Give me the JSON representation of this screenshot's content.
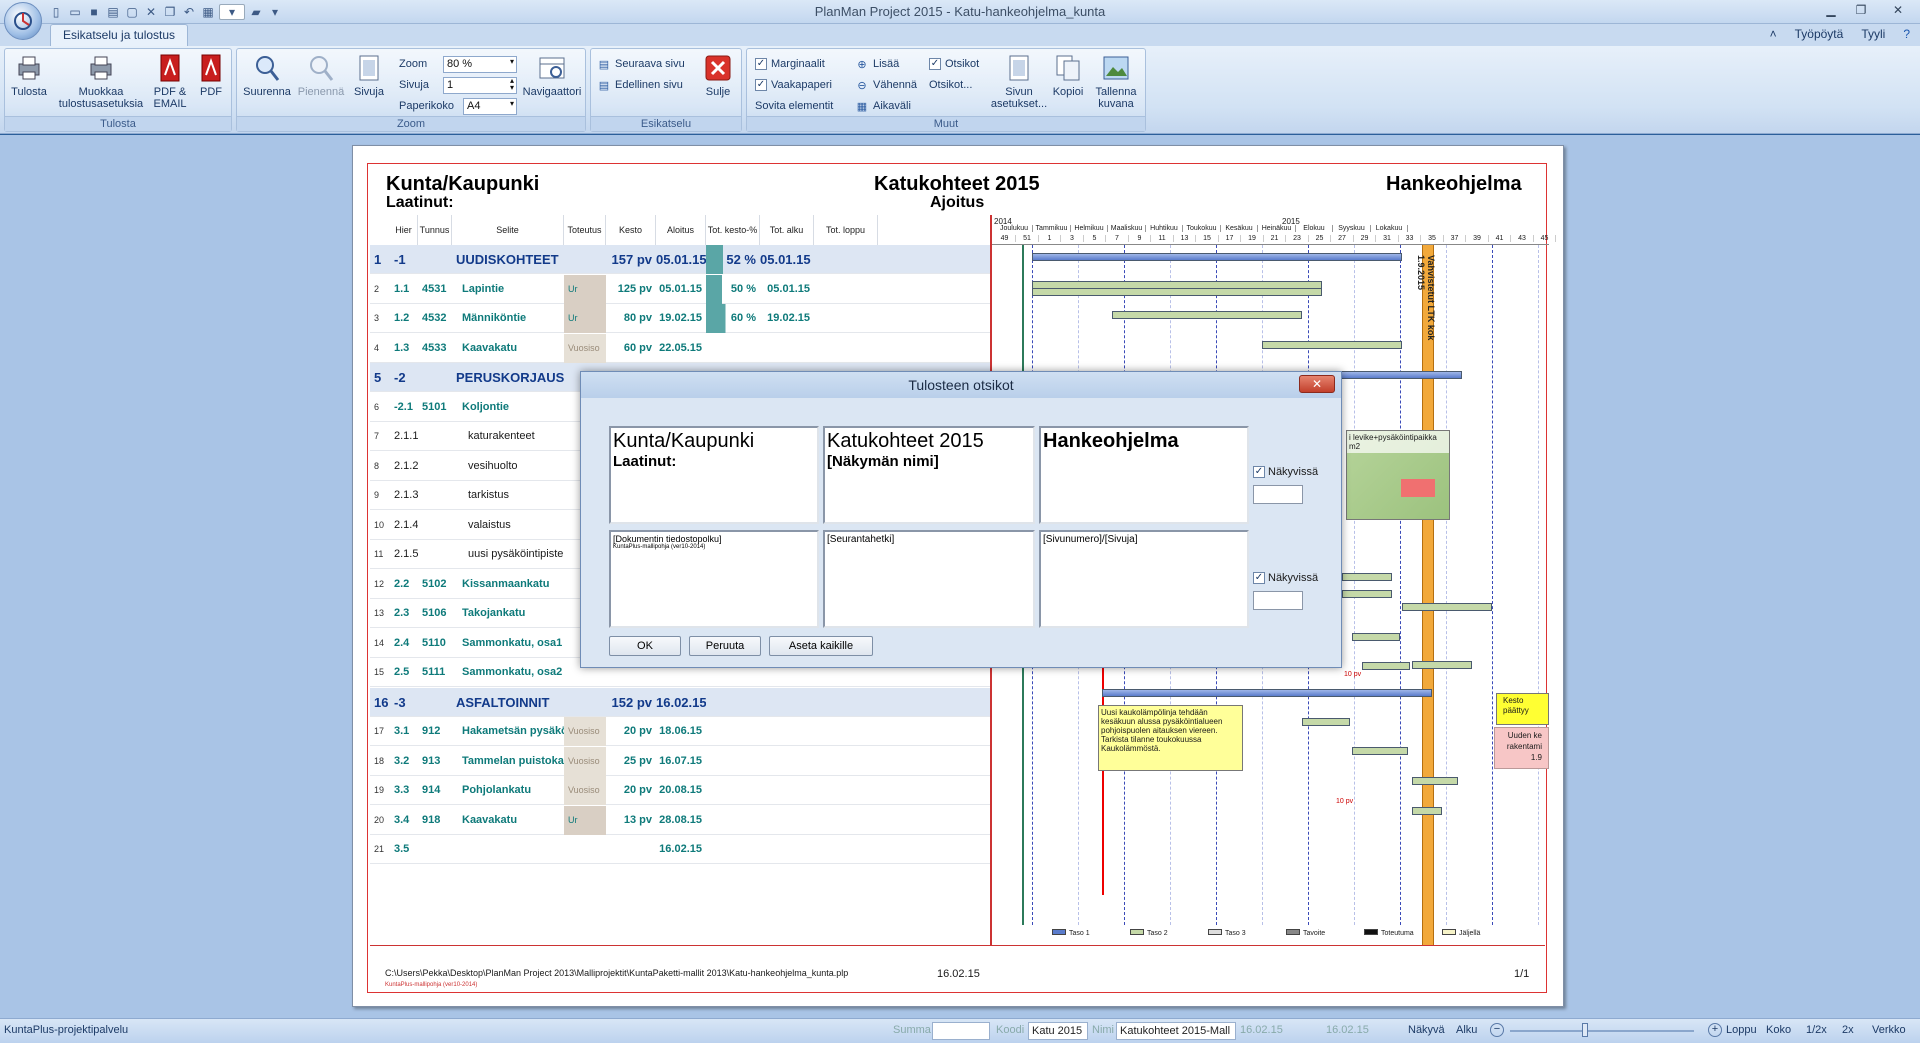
{
  "window": {
    "title": "PlanMan Project 2015 - Katu-hankeohjelma_kunta"
  },
  "tabs": {
    "active": "Esikatselu ja tulostus",
    "right": [
      "Työpöytä",
      "Tyyli"
    ]
  },
  "ribbon": {
    "tulosta": {
      "name": "Tulosta",
      "buttons": [
        "Tulosta",
        "Muokkaa tulostusasetuksia",
        "PDF & EMAIL",
        "PDF"
      ]
    },
    "zoom": {
      "name": "Zoom",
      "buttons": [
        "Suurenna",
        "Pienennä",
        "Sivuja",
        "Navigaattori"
      ],
      "zoom_label": "Zoom",
      "zoom_value": "80 %",
      "sivuja_label": "Sivuja",
      "sivuja_value": "1",
      "paperikoko_label": "Paperikoko",
      "paperikoko_value": "A4"
    },
    "esikatselu": {
      "name": "Esikatselu",
      "next": "Seuraava sivu",
      "prev": "Edellinen sivu",
      "close": "Sulje"
    },
    "muut": {
      "name": "Muut",
      "marginaalit": "Marginaalit",
      "vaakapaperi": "Vaakapaperi",
      "sovita": "Sovita elementit",
      "lisaa": "Lisää",
      "vahenna": "Vähennä",
      "aikavali": "Aikaväli",
      "otsikot": "Otsikot",
      "otsikot2": "Otsikot...",
      "sivun": "Sivun asetukset...",
      "kopioi": "Kopioi",
      "tallenna": "Tallenna kuvana"
    }
  },
  "page": {
    "left_title": "Kunta/Kaupunki",
    "left_sub": "Laatinut:",
    "center_title": "Katukohteet 2015",
    "center_sub": "Ajoitus",
    "right_title": "Hankeohjelma",
    "footer_path": "C:\\Users\\Pekka\\Desktop\\PlanMan Project 2013\\Malliprojektit\\KuntaPaketti-mallit 2013\\Katu-hankeohjelma_kunta.plp",
    "footer_date": "16.02.15",
    "footer_page": "1/1"
  },
  "table": {
    "headers": [
      "Hier",
      "Tunnus",
      "Selite",
      "Toteutus",
      "Kesto",
      "Aloitus",
      "Tot. kesto-%",
      "Tot. alku",
      "Tot. loppu"
    ],
    "rows": [
      {
        "n": "1",
        "hier": "-1",
        "tunnus": "",
        "selite": "UUDISKOHTEET",
        "tot": "",
        "kesto": "157 pv",
        "aloitus": "05.01.15",
        "pct": "52 %",
        "alku": "05.01.15",
        "lvl": 1
      },
      {
        "n": "2",
        "hier": "1.1",
        "tunnus": "4531",
        "selite": "Lapintie",
        "tot": "Ur",
        "kesto": "125 pv",
        "aloitus": "05.01.15",
        "pct": "50 %",
        "alku": "05.01.15",
        "lvl": 2
      },
      {
        "n": "3",
        "hier": "1.2",
        "tunnus": "4532",
        "selite": "Männiköntie",
        "tot": "Ur",
        "kesto": "80 pv",
        "aloitus": "19.02.15",
        "pct": "60 %",
        "alku": "19.02.15",
        "lvl": 2
      },
      {
        "n": "4",
        "hier": "1.3",
        "tunnus": "4533",
        "selite": "Kaavakatu",
        "tot": "Vuosiso",
        "kesto": "60 pv",
        "aloitus": "22.05.15",
        "pct": "",
        "alku": "",
        "lvl": 2
      },
      {
        "n": "5",
        "hier": "-2",
        "tunnus": "",
        "selite": "PERUSKORJAUSKO",
        "tot": "",
        "kesto": "",
        "aloitus": "",
        "pct": "",
        "alku": "",
        "lvl": 1
      },
      {
        "n": "6",
        "hier": "-2.1",
        "tunnus": "5101",
        "selite": "Koljontie",
        "tot": "",
        "kesto": "",
        "aloitus": "",
        "pct": "",
        "alku": "",
        "lvl": 2
      },
      {
        "n": "7",
        "hier": "2.1.1",
        "tunnus": "",
        "selite": "katurakenteet",
        "tot": "",
        "kesto": "",
        "aloitus": "",
        "pct": "",
        "alku": "",
        "lvl": 3
      },
      {
        "n": "8",
        "hier": "2.1.2",
        "tunnus": "",
        "selite": "vesihuolto",
        "tot": "",
        "kesto": "",
        "aloitus": "",
        "pct": "",
        "alku": "",
        "lvl": 3
      },
      {
        "n": "9",
        "hier": "2.1.3",
        "tunnus": "",
        "selite": "tarkistus",
        "tot": "",
        "kesto": "",
        "aloitus": "",
        "pct": "",
        "alku": "",
        "lvl": 3
      },
      {
        "n": "10",
        "hier": "2.1.4",
        "tunnus": "",
        "selite": "valaistus",
        "tot": "",
        "kesto": "",
        "aloitus": "",
        "pct": "",
        "alku": "",
        "lvl": 3
      },
      {
        "n": "11",
        "hier": "2.1.5",
        "tunnus": "",
        "selite": "uusi pysäköintipiste",
        "tot": "",
        "kesto": "",
        "aloitus": "",
        "pct": "",
        "alku": "",
        "lvl": 3
      },
      {
        "n": "12",
        "hier": "2.2",
        "tunnus": "5102",
        "selite": "Kissanmaankatu",
        "tot": "",
        "kesto": "",
        "aloitus": "",
        "pct": "",
        "alku": "",
        "lvl": 2
      },
      {
        "n": "13",
        "hier": "2.3",
        "tunnus": "5106",
        "selite": "Takojankatu",
        "tot": "",
        "kesto": "",
        "aloitus": "",
        "pct": "",
        "alku": "",
        "lvl": 2
      },
      {
        "n": "14",
        "hier": "2.4",
        "tunnus": "5110",
        "selite": "Sammonkatu, osa1",
        "tot": "",
        "kesto": "",
        "aloitus": "",
        "pct": "",
        "alku": "",
        "lvl": 2
      },
      {
        "n": "15",
        "hier": "2.5",
        "tunnus": "5111",
        "selite": "Sammonkatu, osa2",
        "tot": "",
        "kesto": "",
        "aloitus": "",
        "pct": "",
        "alku": "",
        "lvl": 2
      },
      {
        "n": "16",
        "hier": "-3",
        "tunnus": "",
        "selite": "ASFALTOINNIT",
        "tot": "",
        "kesto": "152 pv",
        "aloitus": "16.02.15",
        "pct": "",
        "alku": "",
        "lvl": 1
      },
      {
        "n": "17",
        "hier": "3.1",
        "tunnus": "912",
        "selite": "Hakametsän pysäköintial",
        "tot": "Vuosiso",
        "kesto": "20 pv",
        "aloitus": "18.06.15",
        "pct": "",
        "alku": "",
        "lvl": 2
      },
      {
        "n": "18",
        "hier": "3.2",
        "tunnus": "913",
        "selite": "Tammelan puistokatu, all",
        "tot": "Vuosiso",
        "kesto": "25 pv",
        "aloitus": "16.07.15",
        "pct": "",
        "alku": "",
        "lvl": 2
      },
      {
        "n": "19",
        "hier": "3.3",
        "tunnus": "914",
        "selite": "Pohjolankatu",
        "tot": "Vuosiso",
        "kesto": "20 pv",
        "aloitus": "20.08.15",
        "pct": "",
        "alku": "",
        "lvl": 2
      },
      {
        "n": "20",
        "hier": "3.4",
        "tunnus": "918",
        "selite": "Kaavakatu",
        "tot": "Ur",
        "kesto": "13 pv",
        "aloitus": "28.08.15",
        "pct": "",
        "alku": "",
        "lvl": 2
      },
      {
        "n": "21",
        "hier": "3.5",
        "tunnus": "",
        "selite": "",
        "tot": "",
        "kesto": "",
        "aloitus": "16.02.15",
        "pct": "",
        "alku": "",
        "lvl": 2
      }
    ]
  },
  "gantt": {
    "years": [
      "2014",
      "2015"
    ],
    "months": [
      "Joulukuu",
      "Tammikuu",
      "Helmikuu",
      "Maaliskuu",
      "Huhtikuu",
      "Toukokuu",
      "Kesäkuu",
      "Heinäkuu",
      "Elokuu",
      "Syyskuu",
      "Lokakuu"
    ],
    "weeks": [
      "49",
      "51",
      "1",
      "3",
      "5",
      "7",
      "9",
      "11",
      "13",
      "15",
      "17",
      "19",
      "21",
      "23",
      "25",
      "27",
      "29",
      "31",
      "33",
      "35",
      "37",
      "39",
      "41",
      "43",
      "45"
    ],
    "milestone": "Vahvistetut LTK kok 1.9.2015",
    "note1": "Uusi kaukolämpölinja tehdään kesäkuun alussa pysäköintialueen pohjoispuolen aitauksen viereen. Tarkista tilanne toukokuussa Kaukolämmöstä.",
    "note2": "Kesto päättyy",
    "note3": "Uuden ke rakentami 1.9",
    "note4": "i levike+pysäköintipaikka m2",
    "label_10pv": "10 pv",
    "legend": [
      "Taso 1",
      "Taso 2",
      "Taso 3",
      "Tavoite",
      "Toteutuma",
      "Jäljellä"
    ]
  },
  "dialog": {
    "title": "Tulosteen otsikot",
    "h_left_title": "Kunta/Kaupunki",
    "h_left_sub": "Laatinut:",
    "h_center_title": "Katukohteet 2015",
    "h_center_sub": "[Näkymän nimi]",
    "h_right_title": "Hankeohjelma",
    "f_left": "[Dokumentin tiedostopolku]",
    "f_left_sub": "KuntaPlus-mallipohja (ver10-2014)",
    "f_center": "[Seurantahetki]",
    "f_right": "[Sivunumero]/[Sivuja]",
    "visible_label": "Näkyvissä",
    "ok": "OK",
    "cancel": "Peruuta",
    "set_all": "Aseta kaikille"
  },
  "status": {
    "left": "KuntaPlus-projektipalvelu",
    "summa": "Summa",
    "koodi": "Koodi",
    "koodi_val": "Katu 2015",
    "nimi": "Nimi",
    "nimi_val": "Katukohteet 2015-Mall",
    "date": "16.02.15",
    "date2": "16.02.15",
    "nakyva": "Näkyvä",
    "alku": "Alku",
    "loppu": "Loppu",
    "koko": "Koko",
    "half": "1/2x",
    "double": "2x",
    "verkko": "Verkko"
  }
}
